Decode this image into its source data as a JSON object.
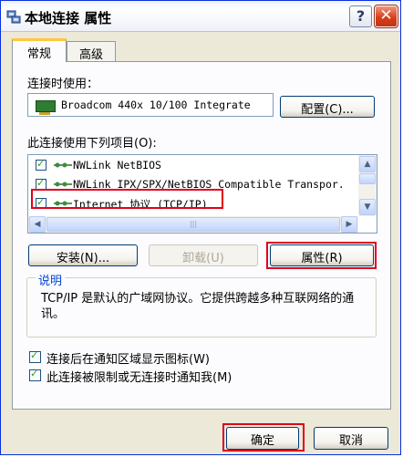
{
  "window": {
    "title": "本地连接 属性",
    "help_button": "?",
    "close_button": "✕"
  },
  "tabs": [
    {
      "label": "常规"
    },
    {
      "label": "高级"
    }
  ],
  "connect_using": {
    "label": "连接时使用：",
    "adapter": "Broadcom 440x 10/100 Integrate",
    "configure_button": "配置(C)..."
  },
  "components": {
    "label": "此连接使用下列项目(O):",
    "items": [
      {
        "label": "NWLink NetBIOS",
        "checked": true
      },
      {
        "label": "NWLink IPX/SPX/NetBIOS Compatible Transpor.",
        "checked": true
      },
      {
        "label": "Internet 协议 (TCP/IP)",
        "checked": true,
        "highlighted": true
      }
    ],
    "scroll_up": "▲",
    "scroll_down": "▼",
    "scroll_left": "◀",
    "scroll_right": "▶",
    "hthumb_grip": "|||"
  },
  "actions": {
    "install": "安装(N)...",
    "uninstall": "卸载(U)",
    "properties": "属性(R)"
  },
  "description": {
    "title": "说明",
    "text": "TCP/IP 是默认的广域网协议。它提供跨越多种互联网络的通讯。"
  },
  "options": [
    {
      "label": "连接后在通知区域显示图标(W)",
      "checked": true
    },
    {
      "label": "此连接被限制或无连接时通知我(M)",
      "checked": true
    }
  ],
  "footer": {
    "ok": "确定",
    "cancel": "取消"
  },
  "colors": {
    "highlight": "#e0001b",
    "group_title": "#0046d5"
  }
}
